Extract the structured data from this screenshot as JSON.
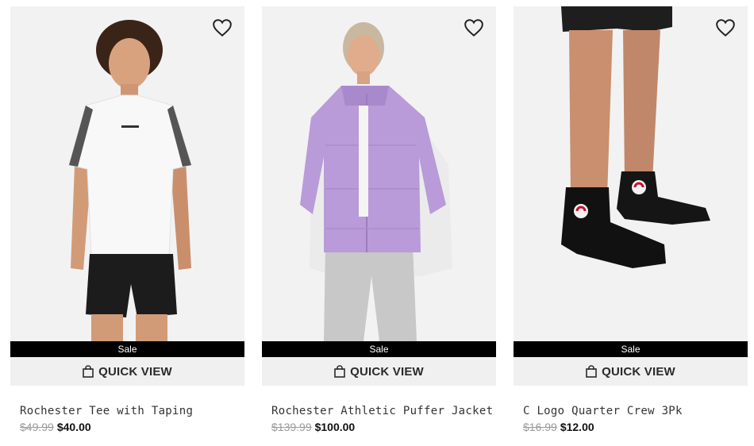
{
  "products": [
    {
      "name": "Rochester Tee with Taping",
      "original_price": "$49.99",
      "sale_price": "$40.00",
      "badge": "Sale",
      "quick_view_label": "QUICK VIEW"
    },
    {
      "name": "Rochester Athletic Puffer Jacket",
      "original_price": "$139.99",
      "sale_price": "$100.00",
      "badge": "Sale",
      "quick_view_label": "QUICK VIEW"
    },
    {
      "name": "C Logo Quarter Crew 3Pk",
      "original_price": "$16.99",
      "sale_price": "$12.00",
      "badge": "Sale",
      "quick_view_label": "QUICK VIEW"
    }
  ],
  "icons": {
    "wishlist": "heart-outline-icon",
    "quick_view": "shopping-bag-icon"
  },
  "colors": {
    "sale_bar": "#000000",
    "quick_view_bg": "#f0f0f0",
    "old_price": "#9a9a9a"
  }
}
